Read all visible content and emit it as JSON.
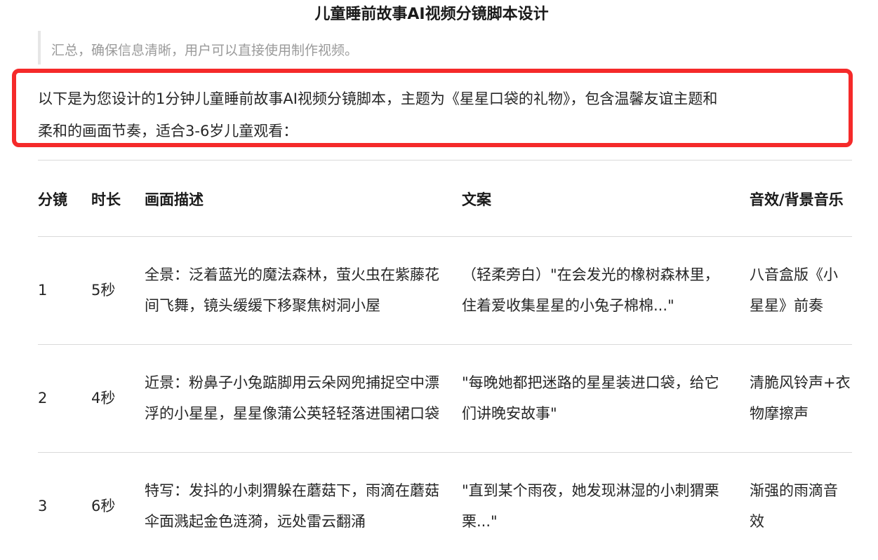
{
  "page": {
    "title": "儿童睡前故事AI视频分镜脚本设计",
    "quote_text": "汇总，确保信息清晰，用户可以直接使用制作视频。"
  },
  "intro": {
    "line1": "以下是为您设计的1分钟儿童睡前故事AI视频分镜脚本，主题为《星星口袋的礼物》，包含温馨友谊主题和",
    "line2": "柔和的画面节奏，适合3-6岁儿童观看："
  },
  "colors": {
    "highlight_border": "#f52a2a",
    "rule": "#d9d9d9",
    "quote_text": "#9a9a9a"
  },
  "table": {
    "headers": {
      "shot": "分镜",
      "duration": "时长",
      "scene": "画面描述",
      "copy": "文案",
      "audio": "音效/背景音乐"
    },
    "rows": [
      {
        "shot": "1",
        "duration": "5秒",
        "scene": "全景：泛着蓝光的魔法森林，萤火虫在紫藤花间飞舞，镜头缓缓下移聚焦树洞小屋",
        "copy": "（轻柔旁白）\"在会发光的橡树森林里，住着爱收集星星的小兔子棉棉...\"",
        "audio": "八音盒版《小星星》前奏"
      },
      {
        "shot": "2",
        "duration": "4秒",
        "scene": "近景：粉鼻子小兔踮脚用云朵网兜捕捉空中漂浮的小星星，星星像蒲公英轻轻落进围裙口袋",
        "copy": "\"每晚她都把迷路的星星装进口袋，给它们讲晚安故事\"",
        "audio": "清脆风铃声+衣物摩擦声"
      },
      {
        "shot": "3",
        "duration": "6秒",
        "scene": "特写：发抖的小刺猬躲在蘑菇下，雨滴在蘑菇伞面溅起金色涟漪，远处雷云翻涌",
        "copy": "\"直到某个雨夜，她发现淋湿的小刺猬栗栗...\"",
        "audio": "渐强的雨滴音效"
      }
    ]
  }
}
